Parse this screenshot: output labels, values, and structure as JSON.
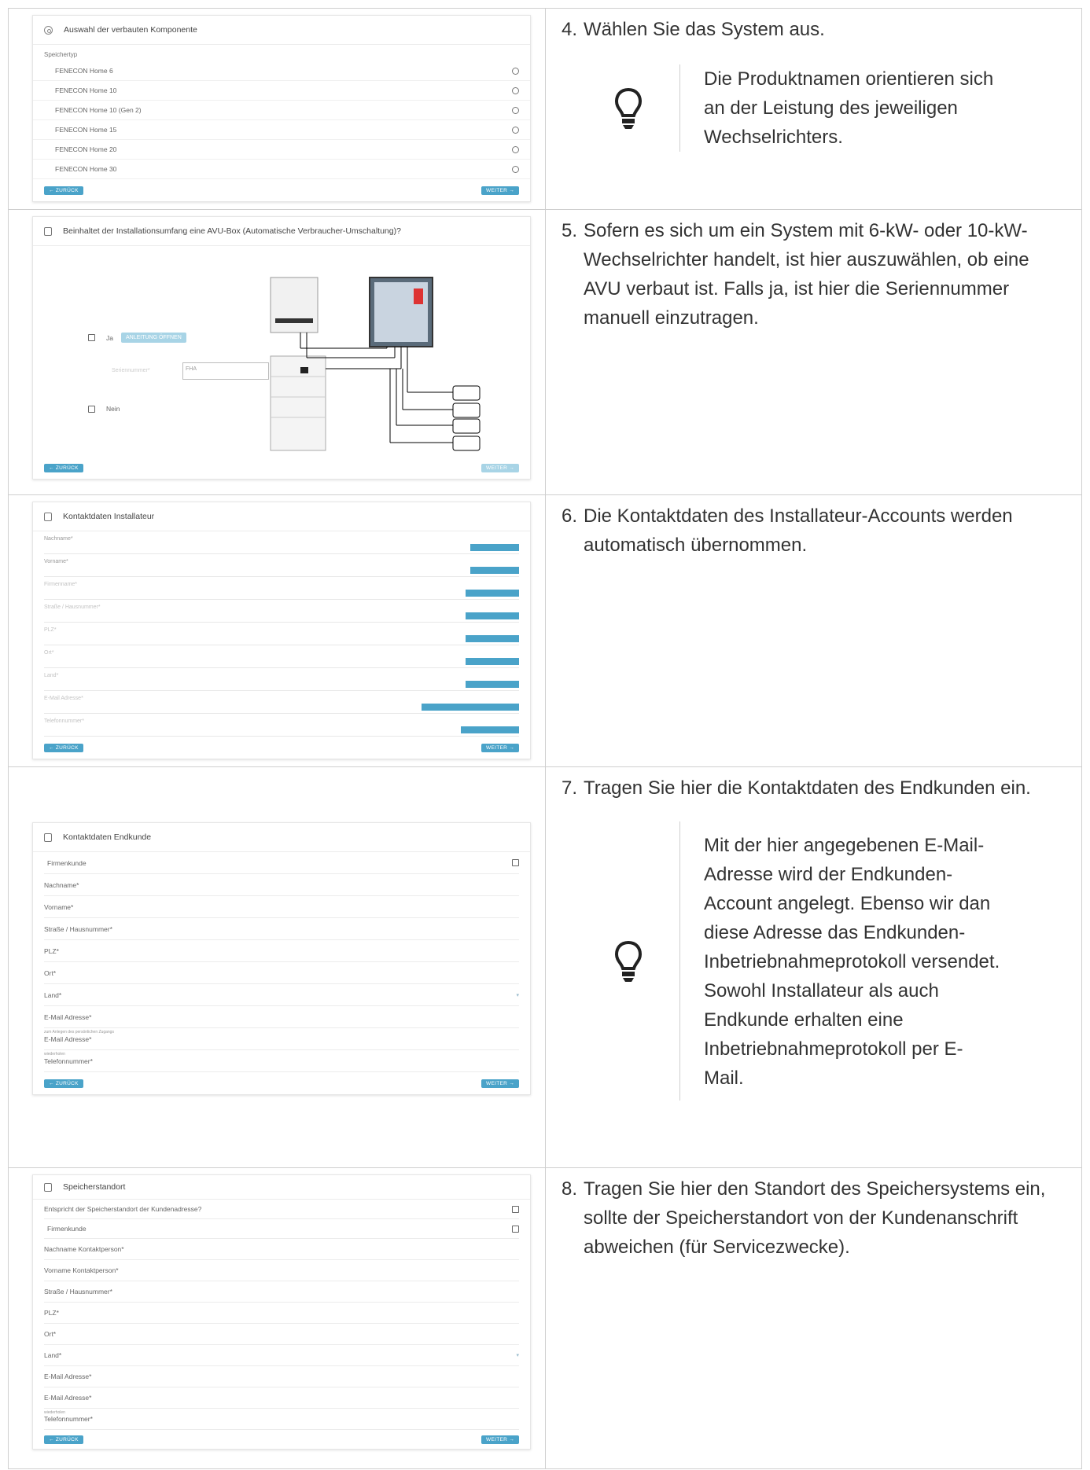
{
  "rows": [
    {
      "screenshot": {
        "title": "Auswahl der verbauten Komponente",
        "sublabel": "Speichertyp",
        "options": [
          "FENECON Home 6",
          "FENECON Home 10",
          "FENECON Home 10 (Gen 2)",
          "FENECON Home 15",
          "FENECON Home 20",
          "FENECON Home 30"
        ],
        "back": "← ZURÜCK",
        "next": "WEITER →"
      },
      "step": {
        "num": "4.",
        "text": "Wählen Sie das System aus."
      },
      "hint": "Die Produktnamen orientieren sich an der Leistung des jeweiligen Wechselrichters."
    },
    {
      "screenshot": {
        "title": "Beinhaltet der Installationsumfang eine AVU-Box (Automatische Verbraucher-Umschaltung)?",
        "opt_yes": "Ja",
        "anleitung": "ANLEITUNG ÖFFNEN",
        "serial_label": "Seriennummer*",
        "serial_value": "FHA",
        "opt_no": "Nein",
        "back": "← ZURÜCK",
        "next": "WEITER →"
      },
      "step": {
        "num": "5.",
        "text": "Sofern es sich um ein System mit 6-kW- oder 10-kW-Wechselrichter handelt, ist hier auszuwählen, ob eine AVU verbaut ist. Falls ja, ist hier die Seriennummer manuell einzutragen."
      }
    },
    {
      "screenshot": {
        "title": "Kontaktdaten Installateur",
        "fields": [
          "Nachname*",
          "Vorname*",
          "Firmenname*",
          "Straße / Hausnummer*",
          "PLZ*",
          "Ort*",
          "Land*",
          "E-Mail Adresse*",
          "Telefonnummer*"
        ],
        "back": "← ZURÜCK",
        "next": "WEITER →"
      },
      "step": {
        "num": "6.",
        "text": "Die Kontaktdaten des Installateur-Accounts werden automatisch übernommen."
      }
    },
    {
      "screenshot": {
        "title": "Kontaktdaten Endkunde",
        "firmenkunde": "Firmenkunde",
        "fields": [
          "Nachname*",
          "Vorname*",
          "Straße / Hausnummer*",
          "PLZ*",
          "Ort*",
          "Land*",
          "E-Mail Adresse*",
          "E-Mail Adresse*",
          "Telefonnummer*"
        ],
        "hint_email1": "zum Anlegen des persönlichen Zugangs",
        "hint_email2": "wiederholen",
        "back": "← ZURÜCK",
        "next": "WEITER →"
      },
      "step": {
        "num": "7.",
        "text": "Tragen Sie hier die Kontaktdaten des Endkunden ein."
      },
      "hint": "Mit der hier angegebenen E-Mail-Adresse wird der Endkunden-Account angelegt. Ebenso wir dan diese Adresse das Endkunden-Inbetriebnahmeprotokoll versendet. Sowohl Installateur als auch Endkunde erhalten eine Inbetriebnahmeprotokoll per E-Mail."
    },
    {
      "screenshot": {
        "title": "Speicherstandort",
        "check1": "Entspricht der Speicherstandort der Kundenadresse?",
        "check2": "Firmenkunde",
        "fields": [
          "Nachname Kontaktperson*",
          "Vorname Kontaktperson*",
          "Straße / Hausnummer*",
          "PLZ*",
          "Ort*",
          "Land*",
          "E-Mail Adresse*",
          "E-Mail Adresse*",
          "Telefonnummer*"
        ],
        "hint_email2": "wiederholen",
        "back": "← ZURÜCK",
        "next": "WEITER →"
      },
      "step": {
        "num": "8.",
        "text": "Tragen Sie hier den Standort des Speichersystems ein, sollte der Speicherstandort von der Kundenanschrift abweichen (für Servicezwecke)."
      }
    }
  ]
}
